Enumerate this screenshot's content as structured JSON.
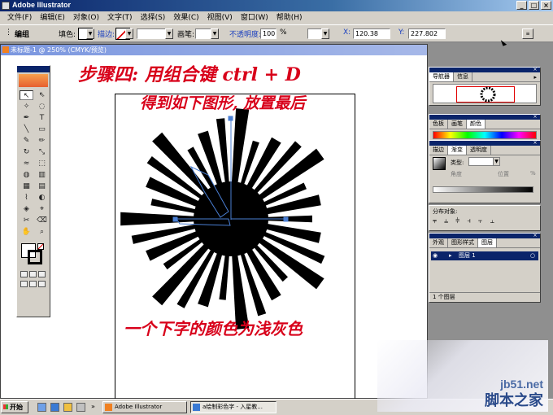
{
  "window": {
    "title": "Adobe Illustrator",
    "min": "_",
    "max": "□",
    "close": "×"
  },
  "menus": [
    "文件(F)",
    "编辑(E)",
    "对象(O)",
    "文字(T)",
    "选择(S)",
    "效果(C)",
    "视图(V)",
    "窗口(W)",
    "帮助(H)"
  ],
  "controlbar": {
    "mode": "编组",
    "fill_label": "填色:",
    "stroke_label": "描边:",
    "style_label": "画笔:",
    "opacity_label": "不透明度:",
    "opacity_value": "100",
    "percent": "%",
    "x_label": "X:",
    "x_value": "120.38",
    "y_label": "Y:",
    "y_value": "227.802"
  },
  "document": {
    "tab_title": "未标题-1 @ 250% (CMYK/预览)"
  },
  "panels": {
    "navigator": {
      "tabs": [
        "导航器",
        "信息"
      ]
    },
    "color": {
      "tabs": [
        "色板",
        "画笔",
        "颜色"
      ]
    },
    "gradient": {
      "tabs": [
        "描边",
        "渐变",
        "透明度"
      ],
      "type_label": "类型:",
      "type_value": "",
      "angle_label": "角度",
      "loc_label": "位置",
      "pct": "%"
    },
    "align": {
      "title": "分布对象:"
    },
    "layers": {
      "tabs": [
        "外观",
        "图形样式",
        "图层"
      ],
      "layer_name": "图层 1",
      "footer": "1 个图层"
    }
  },
  "annotations": {
    "line1": "步骤四: 用组合键 ctrl + D",
    "line2": "得到如下图形, 放置最后",
    "line3": "一个下字的颜色为浅灰色"
  },
  "taskbar": {
    "start": "开始",
    "items": [
      "Adobe Illustrator",
      "a绘制彩色字 - 入星教..."
    ]
  },
  "watermark": {
    "site": "jb51.net",
    "name": "脚本之家"
  },
  "colors": {
    "annotation": "#d8001a",
    "artwork": "#000000",
    "selection": "#4a7fd4"
  }
}
